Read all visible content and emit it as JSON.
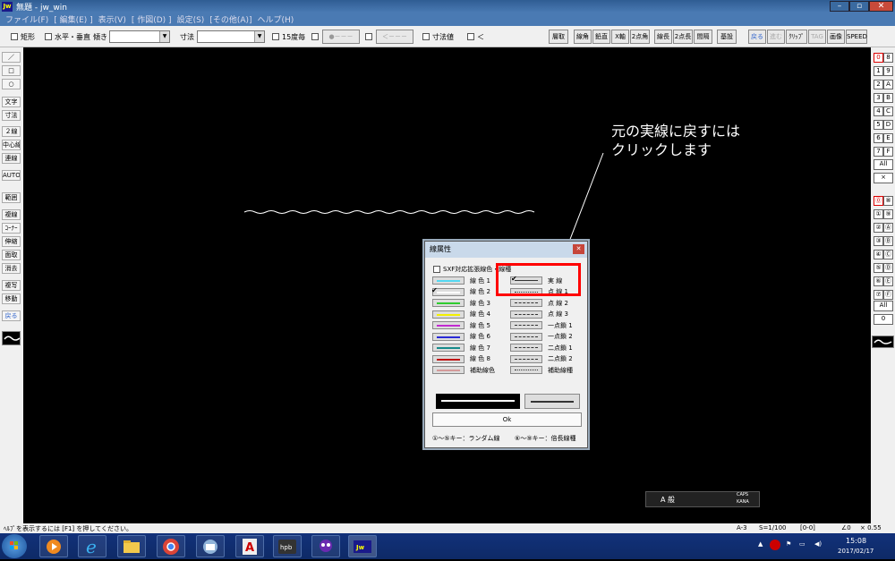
{
  "window": {
    "title": "無題 - jw_win",
    "app_icon": "Jw",
    "minimize": "–",
    "maximize": "▫",
    "close": "✕"
  },
  "menu": [
    "ファイル(F)",
    "[ 編集(E) ]",
    "表示(V)",
    "[ 作図(D) ]",
    "設定(S)",
    "[その他(A)]",
    "ヘルプ(H)"
  ],
  "toolbar": {
    "rect_label": "矩形",
    "hv_label": "水平・垂直",
    "slope_label": "傾き",
    "dim_label": "寸法",
    "deg15_label": "15度毎",
    "pattern1": "●－－－",
    "pattern2": "＜－－－",
    "dimval_label": "寸法値",
    "lt_label": "＜",
    "right_buttons": [
      "層取",
      "線角",
      "鉛直",
      "X軸",
      "2点角",
      "線長",
      "2点長",
      "間隔",
      "基設",
      "戻る",
      "進む",
      "ｸﾘｯﾌﾟ",
      "TAG",
      "画像",
      "SPEED"
    ]
  },
  "left_toolbar": [
    "／",
    "□",
    "○",
    "文字",
    "寸法",
    "２線",
    "中心線",
    "連線",
    "AUTO",
    "範囲",
    "複線",
    "ｺｰﾅｰ",
    "伸縮",
    "面取",
    "消去",
    "複写",
    "移動",
    "戻る"
  ],
  "right_toolbar": {
    "layer_keys": [
      "0",
      "8",
      "1",
      "9",
      "2",
      "A",
      "3",
      "B",
      "4",
      "C",
      "5",
      "D",
      "6",
      "E",
      "7",
      "F"
    ],
    "all": "All",
    "x": "×",
    "group_keys": [
      "⓪",
      "⑧",
      "①",
      "⑨",
      "②",
      "Ⓐ",
      "③",
      "Ⓑ",
      "④",
      "Ⓒ",
      "⑤",
      "Ⓓ",
      "⑥",
      "Ⓔ",
      "⑦",
      "Ⓕ"
    ],
    "all2": "All",
    "zero": "0"
  },
  "annotation": {
    "line1": "元の実線に戻すには",
    "line2": "クリックします"
  },
  "dialog": {
    "title": "線属性",
    "sxf_label": "SXF対応拡張線色・線種",
    "colors": [
      {
        "label": "線 色 1",
        "color": "#54d8f2"
      },
      {
        "label": "線 色 2",
        "color": "#ffffff"
      },
      {
        "label": "線 色 3",
        "color": "#2ecc2e"
      },
      {
        "label": "線 色 4",
        "color": "#f4f000"
      },
      {
        "label": "線 色 5",
        "color": "#c22ad0"
      },
      {
        "label": "線 色 6",
        "color": "#2929d6"
      },
      {
        "label": "線 色 7",
        "color": "#168a8a"
      },
      {
        "label": "線 色 8",
        "color": "#c01414"
      },
      {
        "label": "補助線色",
        "color": "#d49a9a"
      }
    ],
    "linetypes": [
      "実 線",
      "点 線 1",
      "点 線 2",
      "点 線 3",
      "一点鎖 1",
      "一点鎖 2",
      "二点鎖 1",
      "二点鎖 2",
      "補助線種"
    ],
    "ok": "Ok",
    "footer_left": "①～⑤キー：ランダム線",
    "footer_right": "⑥～⑨キー：倍長線種"
  },
  "status": {
    "help": "ﾍﾙﾌﾟを表示するには [F1] を押してください。",
    "paper": "A-3",
    "scale": "S=1/100",
    "layer": "[0-0]",
    "angle": "∠0",
    "factor": "× 0.55"
  },
  "ime": {
    "mode": "A 般",
    "caps": "CAPS",
    "kana": "KANA"
  },
  "taskbar": {
    "time": "15:08",
    "date": "2017/02/17",
    "apps": [
      "media",
      "ie",
      "explorer",
      "chrome",
      "thunderbird",
      "acrobat",
      "hpb",
      "game",
      "jww"
    ]
  }
}
